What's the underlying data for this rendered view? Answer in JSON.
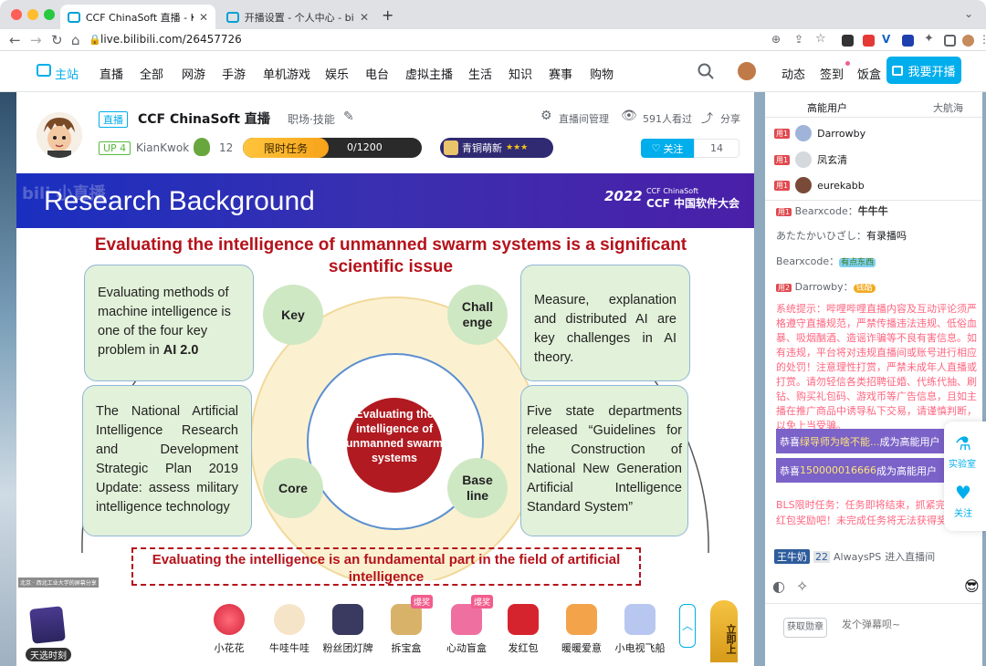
{
  "browser": {
    "tabs": [
      {
        "title": "CCF ChinaSoft 直播 - KianKwok"
      },
      {
        "title": "开播设置 - 个人中心 - bilibili link"
      }
    ],
    "new_tab": "+",
    "url": "live.bilibili.com/26457726"
  },
  "nav": {
    "home": "主站",
    "items": [
      "直播",
      "全部",
      "网游",
      "手游",
      "单机游戏",
      "娱乐",
      "电台",
      "虚拟主播",
      "生活",
      "知识",
      "赛事",
      "购物"
    ],
    "right": [
      "动态",
      "签到",
      "饭盒"
    ],
    "start_live": "我要开播"
  },
  "room": {
    "live_tag": "直播",
    "title": "CCF ChinaSoft 直播",
    "category": "职场·技能",
    "up_level": "UP 4",
    "streamer": "KianKwok",
    "fan_count": "12",
    "task_label": "限时任务",
    "task_progress": "0/1200",
    "task_fraction": 0,
    "fan_medal": "青铜萌新",
    "fan_stars": "★★★",
    "manage": "直播间管理",
    "viewers": "591人看过",
    "share": "分享",
    "follow": "关注",
    "follow_count": "14"
  },
  "slide": {
    "watermark": "bili 小直播",
    "title": "Research Background",
    "logo_small": "CCF ChinaSoft",
    "logo_main": "CCF 中国软件大会",
    "year": "2022",
    "headline": "Evaluating the intelligence of unmanned swarm systems is a significant scientific issue",
    "box_tl_pre": "Evaluating methods of machine intelligence is one of the four key problem in ",
    "box_tl_bold": "AI 2.0",
    "box_tr": "Measure, explanation and distributed AI are key challenges in AI theory.",
    "box_bl": "The National Artificial Intelligence Research and Development Strategic Plan 2019 Update: assess military intelligence technology",
    "box_br": "Five state departments released “Guidelines for the Construction of National New Generation Artificial Intelligence Standard System”",
    "key": "Key",
    "challenge": "Chall enge",
    "core": "Core",
    "baseline": "Base line",
    "center": "Evaluating the intelligence of unmanned swarm systems",
    "footer": "Evaluating the intelligence is an fundamental part in the field of artificial intelligence",
    "caption": "北京 · 西北工业大学的屏幕分享"
  },
  "gifts": {
    "draw": "天选时刻",
    "items": [
      {
        "name": "小花花",
        "badge": ""
      },
      {
        "name": "牛哇牛哇",
        "badge": ""
      },
      {
        "name": "粉丝团灯牌",
        "badge": ""
      },
      {
        "name": "拆宝盒",
        "badge": "爆奖"
      },
      {
        "name": "心动盲盒",
        "badge": "爆奖"
      },
      {
        "name": "发红包",
        "badge": ""
      },
      {
        "name": "暖暖爱意",
        "badge": ""
      },
      {
        "name": "小电视飞船",
        "badge": ""
      }
    ],
    "expand": "︿",
    "top": "立即上"
  },
  "panel": {
    "tab_high": "高能用户",
    "tab_fleet": "大航海",
    "rank": [
      {
        "medal": "用1",
        "name": "Darrowby"
      },
      {
        "medal": "用1",
        "name": "凤玄清"
      },
      {
        "medal": "用1",
        "name": "eurekabb"
      }
    ],
    "chat": [
      {
        "medal": "用1",
        "user": "Bearxcode：",
        "text": "牛牛牛"
      },
      {
        "medal": "",
        "user": "あたたかいひざし：",
        "text": "有录播吗"
      },
      {
        "medal": "",
        "user": "Bearxcode：",
        "text": "有点东西"
      },
      {
        "medal": "用2",
        "user": "Darrowby：",
        "text": "钱酷"
      }
    ],
    "system": "系统提示：哔哩哔哩直播内容及互动评论须严格遵守直播规范，严禁传播违法违规、低俗血暴、吸烟酗酒、造谣诈骗等不良有害信息。如有违规，平台将对违规直播间或账号进行相应的处罚！注意理性打赏，严禁未成年人直播或打赏。请勿轻信各类招聘征婚、代练代抽、刷钻、购买礼包码、游戏币等广告信息，且如主播在推广商品中诱导私下交易，请谨慎判断，以免上当受骗。",
    "congrats": [
      {
        "pre": "恭喜 ",
        "who": "绿导师为啥不能...",
        "post": " 成为高能用户"
      },
      {
        "pre": "恭喜 ",
        "who": "150000016666",
        "post": " 成为高能用户"
      }
    ],
    "bls": "BLS限时任务：任务即将结束，抓紧完成获得红包奖励吧！未完成任务将无法获得奖励哦~",
    "enter_badge": "王牛奶",
    "enter_level": "22",
    "enter_user": "AlwaysPS",
    "enter_text": "进入直播间",
    "lab": "实验室",
    "follow_side": "关注",
    "medal_btn": "获取勋章",
    "input_placeholder": "发个弹幕呗~"
  }
}
